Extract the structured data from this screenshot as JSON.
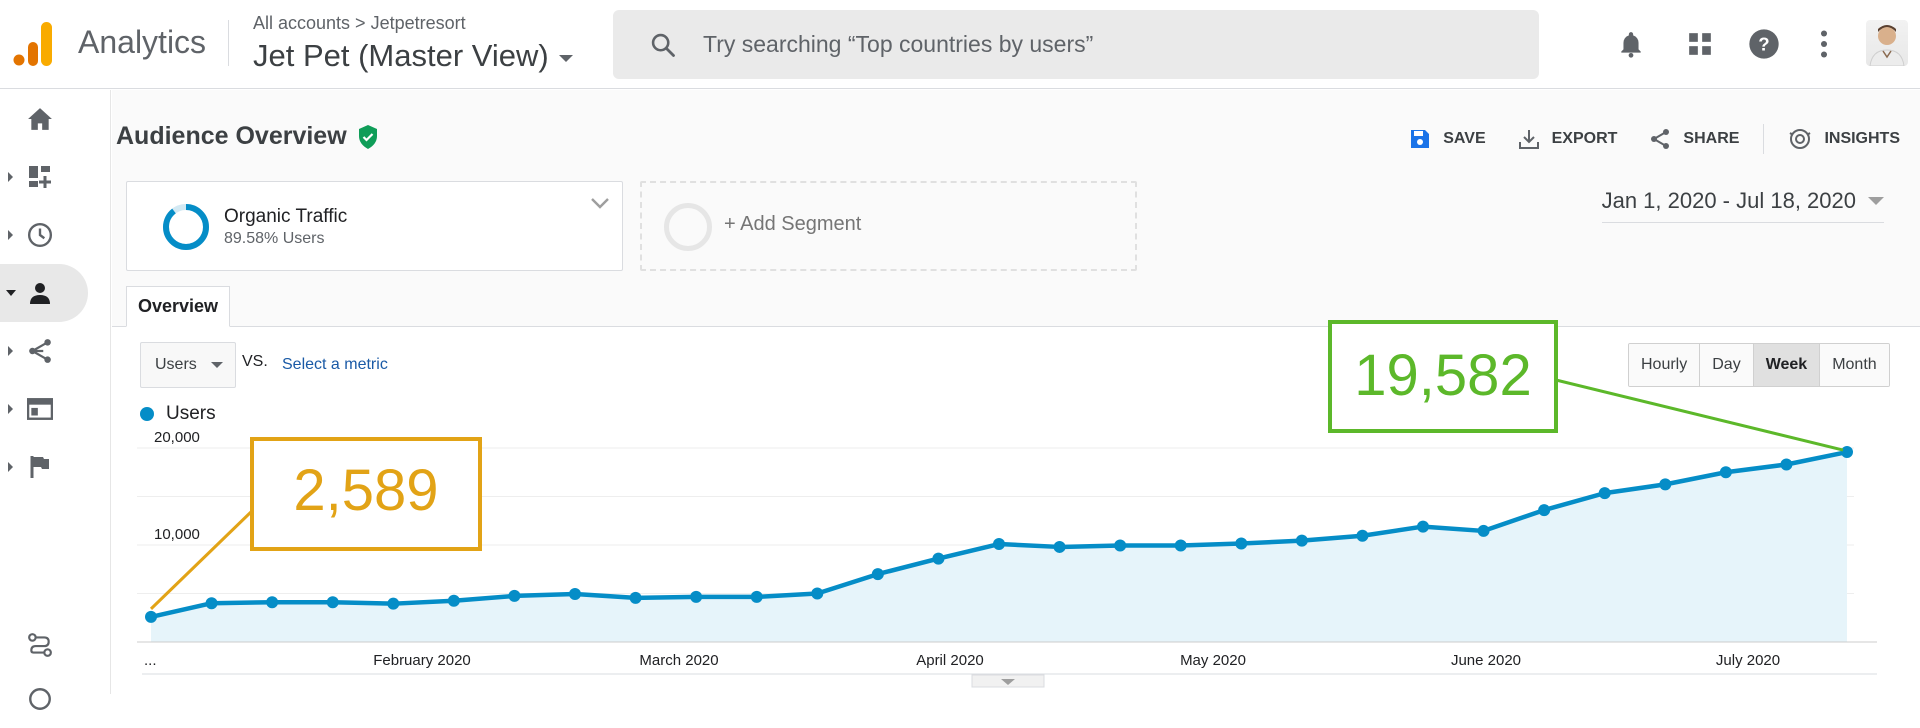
{
  "header": {
    "app_name": "Analytics",
    "breadcrumb": "All accounts > Jetpetresort",
    "view_name": "Jet Pet (Master View)",
    "search_placeholder": "Try searching “Top countries by users”"
  },
  "page": {
    "title": "Audience Overview",
    "actions": {
      "save": "SAVE",
      "export": "EXPORT",
      "share": "SHARE",
      "insights": "INSIGHTS"
    }
  },
  "segment": {
    "name": "Organic Traffic",
    "sub": "89.58% Users",
    "add_label": "+ Add Segment"
  },
  "date_range": "Jan 1, 2020 - Jul 18, 2020",
  "tab": "Overview",
  "controls": {
    "metric": "Users",
    "vs": "VS.",
    "select_metric": "Select a metric",
    "granularity": [
      "Hourly",
      "Day",
      "Week",
      "Month"
    ],
    "granularity_selected": "Week"
  },
  "colors": {
    "series": "#058dc7",
    "area": "#e6f4fa",
    "callout_start": "#e2a316",
    "callout_end": "#5cb82a"
  },
  "chart_data": {
    "type": "area",
    "series": [
      {
        "name": "Users",
        "values": [
          2589,
          4000,
          4100,
          4100,
          3950,
          4250,
          4750,
          4950,
          4550,
          4650,
          4650,
          5000,
          7000,
          8600,
          10100,
          9800,
          9950,
          9950,
          10150,
          10450,
          10950,
          11900,
          11450,
          13600,
          15350,
          16250,
          17500,
          18300,
          19582
        ]
      }
    ],
    "x_tick_labels": [
      "...",
      "February 2020",
      "March 2020",
      "April 2020",
      "May 2020",
      "June 2020",
      "July 2020"
    ],
    "y_tick_labels": [
      "20,000",
      "10,000"
    ],
    "ylim": [
      0,
      20000
    ],
    "grid": true,
    "legend": "top-left",
    "annotations": [
      {
        "text": "2,589",
        "point_index": 0,
        "color": "#e2a316"
      },
      {
        "text": "19,582",
        "point_index": 28,
        "color": "#5cb82a"
      }
    ]
  }
}
